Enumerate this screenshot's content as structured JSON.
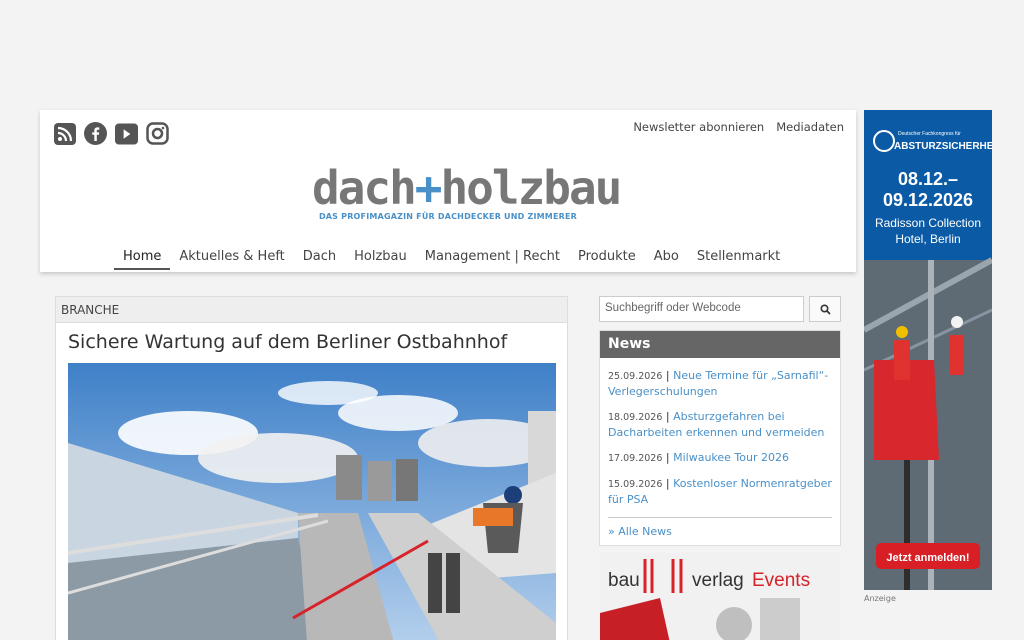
{
  "header": {
    "social_icons": [
      "rss-icon",
      "facebook-icon",
      "youtube-icon",
      "instagram-icon"
    ],
    "top_links": [
      "Newsletter abonnieren",
      "Mediadaten"
    ],
    "logo": {
      "left": "dach",
      "plus": "+",
      "right": "holzbau",
      "tagline": "DAS PROFIMAGAZIN FÜR DACHDECKER UND ZIMMERER"
    },
    "nav": [
      {
        "label": "Home",
        "active": true
      },
      {
        "label": "Aktuelles & Heft"
      },
      {
        "label": "Dach"
      },
      {
        "label": "Holzbau"
      },
      {
        "label": "Management | Recht"
      },
      {
        "label": "Produkte"
      },
      {
        "label": "Abo"
      },
      {
        "label": "Stellenmarkt"
      }
    ]
  },
  "article": {
    "category": "BRANCHE",
    "title": "Sichere Wartung auf dem Berliner Ostbahnhof"
  },
  "search": {
    "placeholder": "Suchbegriff oder Webcode"
  },
  "news": {
    "heading": "News",
    "items": [
      {
        "date": "25.09.2026",
        "title": "Neue Termine für „Sarnafil“-Verlegerschulungen"
      },
      {
        "date": "18.09.2026",
        "title": "Absturzgefahren bei Dacharbeiten erkennen und vermeiden"
      },
      {
        "date": "17.09.2026",
        "title": "Milwaukee Tour 2026"
      },
      {
        "date": "15.09.2026",
        "title": "Kostenloser Normenratgeber für PSA"
      }
    ],
    "all_link": "» Alle News"
  },
  "promo": {
    "bau": "bau",
    "verlag": "verlag",
    "events": "Events"
  },
  "ad": {
    "small_line": "Deutscher Fachkongress für",
    "brand": "ABSTURZSICHERHEIT",
    "date1": "08.12.–",
    "date2": "09.12.2026",
    "venue1": "Radisson Collection",
    "venue2": "Hotel, Berlin",
    "cta": "Jetzt anmelden!",
    "label": "Anzeige"
  },
  "colors": {
    "accent": "#4a90c8",
    "news_header": "#666666",
    "ad_blue": "#0b5aa5",
    "ad_cta": "#d81f26"
  }
}
